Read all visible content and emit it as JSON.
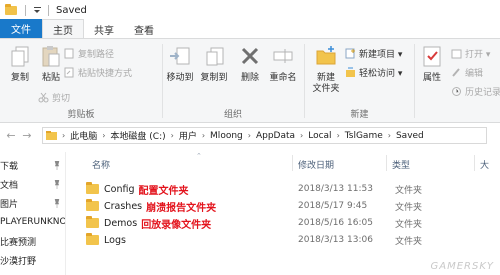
{
  "window": {
    "title": "Saved"
  },
  "tabs": [
    {
      "label": "文件"
    },
    {
      "label": "主页"
    },
    {
      "label": "共享"
    },
    {
      "label": "查看"
    }
  ],
  "ribbon": {
    "clipboard": {
      "group_label": "剪贴板",
      "copy": "复制",
      "paste": "粘贴",
      "cut": "剪切",
      "copy_path": "复制路径",
      "paste_shortcut": "粘贴快捷方式"
    },
    "organize": {
      "group_label": "组织",
      "move_to": "移动到",
      "copy_to": "复制到",
      "delete": "删除",
      "rename": "重命名"
    },
    "new": {
      "group_label": "新建",
      "new_folder_line1": "新建",
      "new_folder_line2": "文件夹",
      "new_item": "新建项目 ▾",
      "easy_access": "轻松访问 ▾"
    },
    "open": {
      "properties": "属性",
      "open": "打开 ▾",
      "edit": "编辑",
      "history": "历史记录"
    }
  },
  "address": {
    "crumbs": [
      "此电脑",
      "本地磁盘 (C:)",
      "用户",
      "Mloong",
      "AppData",
      "Local",
      "TslGame",
      "Saved"
    ]
  },
  "nav": {
    "items": [
      "下载",
      "文档",
      "图片",
      "PLAYERUNKNO",
      "比赛预测",
      "沙漠打野"
    ]
  },
  "columns": {
    "name": "名称",
    "date": "修改日期",
    "type": "类型",
    "size": "大"
  },
  "files": [
    {
      "name": "Config",
      "note": "配置文件夹",
      "date": "2018/3/13 11:53",
      "type": "文件夹"
    },
    {
      "name": "Crashes",
      "note": "崩溃报告文件夹",
      "date": "2018/5/17 9:45",
      "type": "文件夹"
    },
    {
      "name": "Demos",
      "note": "回放录像文件夹",
      "date": "2018/5/16 16:05",
      "type": "文件夹"
    },
    {
      "name": "Logs",
      "note": "",
      "date": "2018/3/13 13:06",
      "type": "文件夹"
    }
  ],
  "watermark": "GAMERSKY",
  "colors": {
    "file_tab": "#1979ca",
    "annotation": "#e3131c",
    "folder": "#f2c44c"
  }
}
